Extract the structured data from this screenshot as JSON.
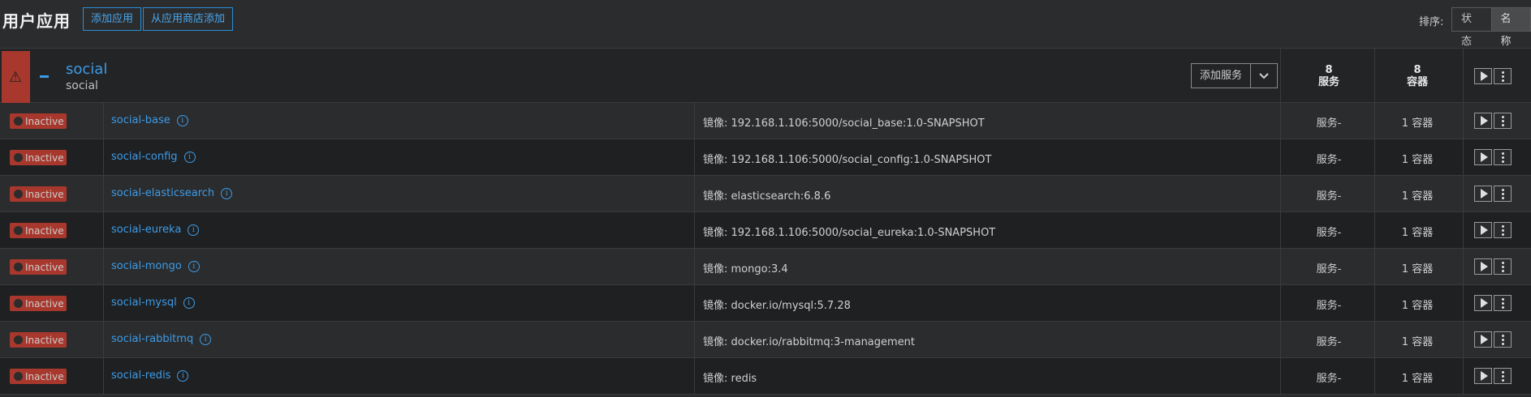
{
  "header": {
    "title": "用户应用",
    "add_app_label": "添加应用",
    "add_from_store_label": "从应用商店添加",
    "sort_label": "排序:",
    "sort_options": [
      "状态",
      "名称"
    ],
    "sort_selected": "名称"
  },
  "stack": {
    "name": "social",
    "subtitle": "social",
    "add_service_label": "添加服务",
    "services_count": "8",
    "services_label": "服务",
    "containers_count": "8",
    "containers_label": "容器",
    "status_color": "#a8382d",
    "accent_color": "#3d9be6"
  },
  "services": [
    {
      "status": "Inactive",
      "name": "social-base",
      "image": "镜像: 192.168.1.106:5000/social_base:1.0-SNAPSHOT",
      "service_text": "服务-",
      "containers": "1 容器"
    },
    {
      "status": "Inactive",
      "name": "social-config",
      "image": "镜像: 192.168.1.106:5000/social_config:1.0-SNAPSHOT",
      "service_text": "服务-",
      "containers": "1 容器"
    },
    {
      "status": "Inactive",
      "name": "social-elasticsearch",
      "image": "镜像: elasticsearch:6.8.6",
      "service_text": "服务-",
      "containers": "1 容器"
    },
    {
      "status": "Inactive",
      "name": "social-eureka",
      "image": "镜像: 192.168.1.106:5000/social_eureka:1.0-SNAPSHOT",
      "service_text": "服务-",
      "containers": "1 容器"
    },
    {
      "status": "Inactive",
      "name": "social-mongo",
      "image": "镜像: mongo:3.4",
      "service_text": "服务-",
      "containers": "1 容器"
    },
    {
      "status": "Inactive",
      "name": "social-mysql",
      "image": "镜像: docker.io/mysql:5.7.28",
      "service_text": "服务-",
      "containers": "1 容器"
    },
    {
      "status": "Inactive",
      "name": "social-rabbitmq",
      "image": "镜像: docker.io/rabbitmq:3-management",
      "service_text": "服务-",
      "containers": "1 容器"
    },
    {
      "status": "Inactive",
      "name": "social-redis",
      "image": "镜像: redis",
      "service_text": "服务-",
      "containers": "1 容器"
    }
  ],
  "icons": {
    "warning": "warning-icon",
    "collapse": "collapse-icon",
    "play": "play-icon",
    "more": "kebab-menu-icon",
    "info": "info-icon",
    "caret": "chevron-down-icon"
  }
}
